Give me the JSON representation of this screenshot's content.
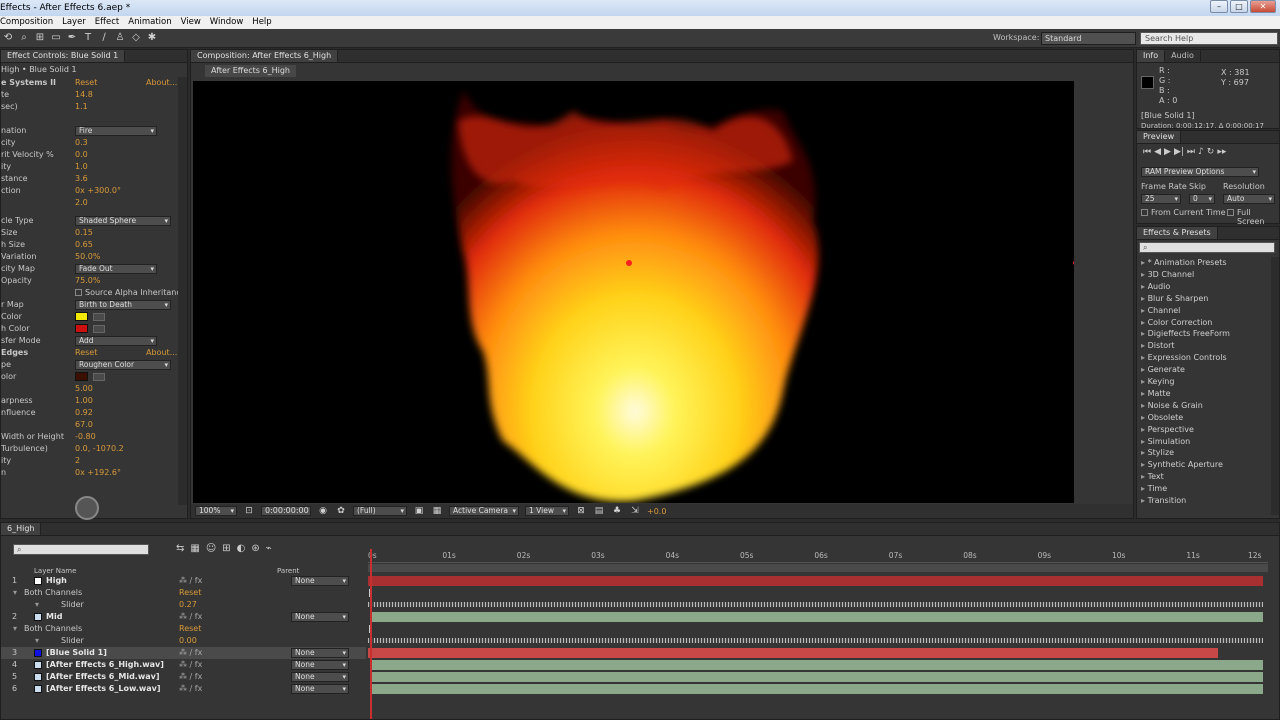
{
  "window": {
    "title": "Effects - After Effects 6.aep *",
    "min": "–",
    "max": "□",
    "close": "✕"
  },
  "menu": [
    "Composition",
    "Layer",
    "Effect",
    "Animation",
    "View",
    "Window",
    "Help"
  ],
  "toolbar": {
    "workspace_label": "Workspace:",
    "workspace_value": "Standard",
    "search_placeholder": "Search Help"
  },
  "effect_controls": {
    "tab": "Effect Controls: Blue Solid 1",
    "breadcrumb": "High • Blue Solid 1",
    "sections": [
      {
        "name": "e Systems II",
        "reset": "Reset",
        "about": "About..."
      },
      {
        "name": "Edges",
        "reset": "Reset",
        "about": "About..."
      }
    ],
    "rows": [
      {
        "label": "te",
        "value": "14.8"
      },
      {
        "label": "sec)",
        "value": "1.1"
      },
      {
        "label": "nation",
        "dropdown": "Fire"
      },
      {
        "label": "city",
        "value": "0.3"
      },
      {
        "label": "rit Velocity %",
        "value": "0.0"
      },
      {
        "label": "ity",
        "value": "1.0"
      },
      {
        "label": "stance",
        "value": "3.6"
      },
      {
        "label": "ction",
        "value": "0x +300.0°"
      },
      {
        "label": "",
        "value": "2.0"
      },
      {
        "label": "cle Type",
        "dropdown": "Shaded Sphere"
      },
      {
        "label": "Size",
        "value": "0.15"
      },
      {
        "label": "h Size",
        "value": "0.65"
      },
      {
        "label": "Variation",
        "value": "50.0%"
      },
      {
        "label": "city Map",
        "dropdown": "Fade Out"
      },
      {
        "label": "Opacity",
        "value": "75.0%"
      },
      {
        "label": "",
        "checkbox": "Source Alpha Inheritanc"
      },
      {
        "label": "r Map",
        "dropdown": "Birth to Death"
      },
      {
        "label": "Color",
        "color": "#f2e800"
      },
      {
        "label": "h Color",
        "color": "#cc1010"
      },
      {
        "label": "sfer Mode",
        "dropdown": "Add"
      },
      {
        "label": "pe",
        "dropdown": "Roughen Color"
      },
      {
        "label": "olor",
        "color": "#3a1000"
      },
      {
        "label": "",
        "value": "5.00"
      },
      {
        "label": "arpness",
        "value": "1.00"
      },
      {
        "label": "nfluence",
        "value": "0.92"
      },
      {
        "label": "",
        "value": "67.0"
      },
      {
        "label": "Width or Height",
        "value": "-0.80"
      },
      {
        "label": "Turbulence)",
        "value": "0.0, -1070.2"
      },
      {
        "label": "ity",
        "value": "2"
      },
      {
        "label": "n",
        "value": "0x +192.6°"
      }
    ]
  },
  "composition": {
    "tab": "Composition: After Effects 6_High",
    "subtab": "After Effects 6_High",
    "zoom": "100%",
    "timecode": "0:00:00:00",
    "resolution": "(Full)",
    "camera": "Active Camera",
    "view": "1 View",
    "exposure": "+0.0"
  },
  "info": {
    "tabs": [
      "Info",
      "Audio"
    ],
    "r": "R :",
    "g": "G :",
    "b": "B :",
    "a": "A : 0",
    "x": "X : 381",
    "y": "Y : 697",
    "layer": "[Blue Solid 1]",
    "duration": "Duration: 0;00;12;17, Δ 0;00;00;17"
  },
  "preview": {
    "tab": "Preview",
    "ram": "RAM Preview Options",
    "frame_rate_label": "Frame Rate",
    "skip_label": "Skip",
    "resolution_label": "Resolution",
    "frame_rate": "25",
    "skip": "0",
    "resolution": "Auto",
    "from_current": "From Current Time",
    "full_screen": "Full Screen"
  },
  "effects_presets": {
    "tab": "Effects & Presets",
    "items": [
      "* Animation Presets",
      "3D Channel",
      "Audio",
      "Blur & Sharpen",
      "Channel",
      "Color Correction",
      "Digieffects FreeForm",
      "Distort",
      "Expression Controls",
      "Generate",
      "Keying",
      "Matte",
      "Noise & Grain",
      "Obsolete",
      "Perspective",
      "Simulation",
      "Stylize",
      "Synthetic Aperture",
      "Text",
      "Time",
      "Transition"
    ]
  },
  "timeline": {
    "tab": "6_High",
    "col_layer": "Layer Name",
    "col_parent": "Parent",
    "ruler": [
      "0s",
      "01s",
      "02s",
      "03s",
      "04s",
      "05s",
      "06s",
      "07s",
      "08s",
      "09s",
      "10s",
      "11s",
      "12s"
    ],
    "layers": [
      {
        "num": "1",
        "name": "High",
        "parent": "None",
        "kind": "layer"
      },
      {
        "num": "",
        "name": "Both Channels",
        "parent": "Reset",
        "kind": "effect"
      },
      {
        "num": "",
        "name": "Slider",
        "parent": "0.27",
        "kind": "sub"
      },
      {
        "num": "2",
        "name": "Mid",
        "parent": "None",
        "kind": "layer"
      },
      {
        "num": "",
        "name": "Both Channels",
        "parent": "Reset",
        "kind": "effect"
      },
      {
        "num": "",
        "name": "Slider",
        "parent": "0.00",
        "kind": "sub"
      },
      {
        "num": "3",
        "name": "[Blue Solid 1]",
        "parent": "None",
        "kind": "layer"
      },
      {
        "num": "4",
        "name": "[After Effects 6_High.wav]",
        "parent": "None",
        "kind": "layer"
      },
      {
        "num": "5",
        "name": "[After Effects 6_Mid.wav]",
        "parent": "None",
        "kind": "layer"
      },
      {
        "num": "6",
        "name": "[After Effects 6_Low.wav]",
        "parent": "None",
        "kind": "layer"
      }
    ]
  }
}
